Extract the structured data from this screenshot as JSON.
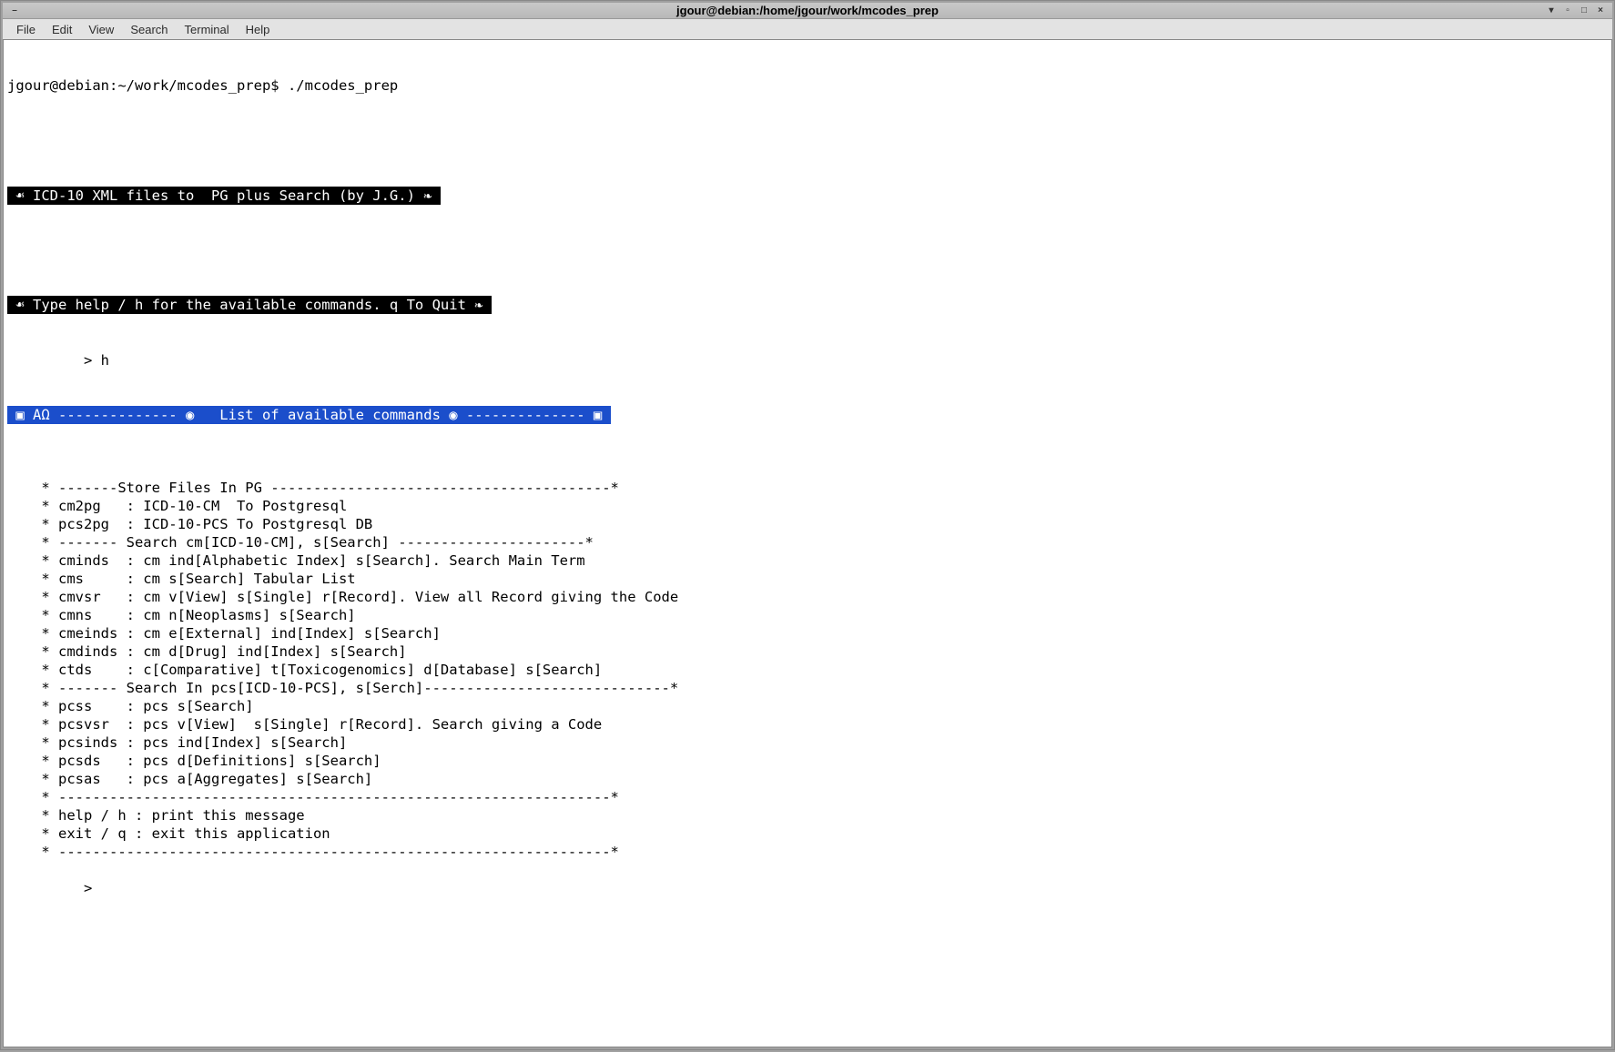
{
  "window": {
    "title": "jgour@debian:/home/jgour/work/mcodes_prep",
    "left_btn": "–",
    "right_btns": [
      "▾",
      "▫",
      "□",
      "×"
    ]
  },
  "menu": {
    "file": "File",
    "edit": "Edit",
    "view": "View",
    "search": "Search",
    "terminal": "Terminal",
    "help": "Help"
  },
  "prompt_line": "jgour@debian:~/work/mcodes_prep$ ./mcodes_prep",
  "banner1": " ☙ ICD-10 XML files to  PG plus Search (by J.G.) ❧ ",
  "banner2": " ☙ Type help / h for the available commands. q To Quit ❧ ",
  "input1": "         > h",
  "banner3": " ▣ ΑΩ -------------- ◉   List of available commands ◉ -------------- ▣ ",
  "lines": [
    "",
    "    * -------Store Files In PG ----------------------------------------*",
    "    * cm2pg   : ICD-10-CM  To Postgresql",
    "    * pcs2pg  : ICD-10-PCS To Postgresql DB",
    "    * ------- Search cm[ICD-10-CM], s[Search] ----------------------*",
    "    * cminds  : cm ind[Alphabetic Index] s[Search]. Search Main Term",
    "    * cms     : cm s[Search] Tabular List",
    "    * cmvsr   : cm v[View] s[Single] r[Record]. View all Record giving the Code",
    "    * cmns    : cm n[Neoplasms] s[Search]",
    "    * cmeinds : cm e[External] ind[Index] s[Search]",
    "    * cmdinds : cm d[Drug] ind[Index] s[Search]",
    "    * ctds    : c[Comparative] t[Toxicogenomics] d[Database] s[Search]",
    "    * ------- Search In pcs[ICD-10-PCS], s[Serch]-----------------------------*",
    "    * pcss    : pcs s[Search]",
    "    * pcsvsr  : pcs v[View]  s[Single] r[Record]. Search giving a Code",
    "    * pcsinds : pcs ind[Index] s[Search]",
    "    * pcsds   : pcs d[Definitions] s[Search]",
    "    * pcsas   : pcs a[Aggregates] s[Search]",
    "    * -----------------------------------------------------------------*",
    "    * help / h : print this message",
    "    * exit / q : exit this application",
    "    * -----------------------------------------------------------------*",
    "",
    "         >"
  ]
}
